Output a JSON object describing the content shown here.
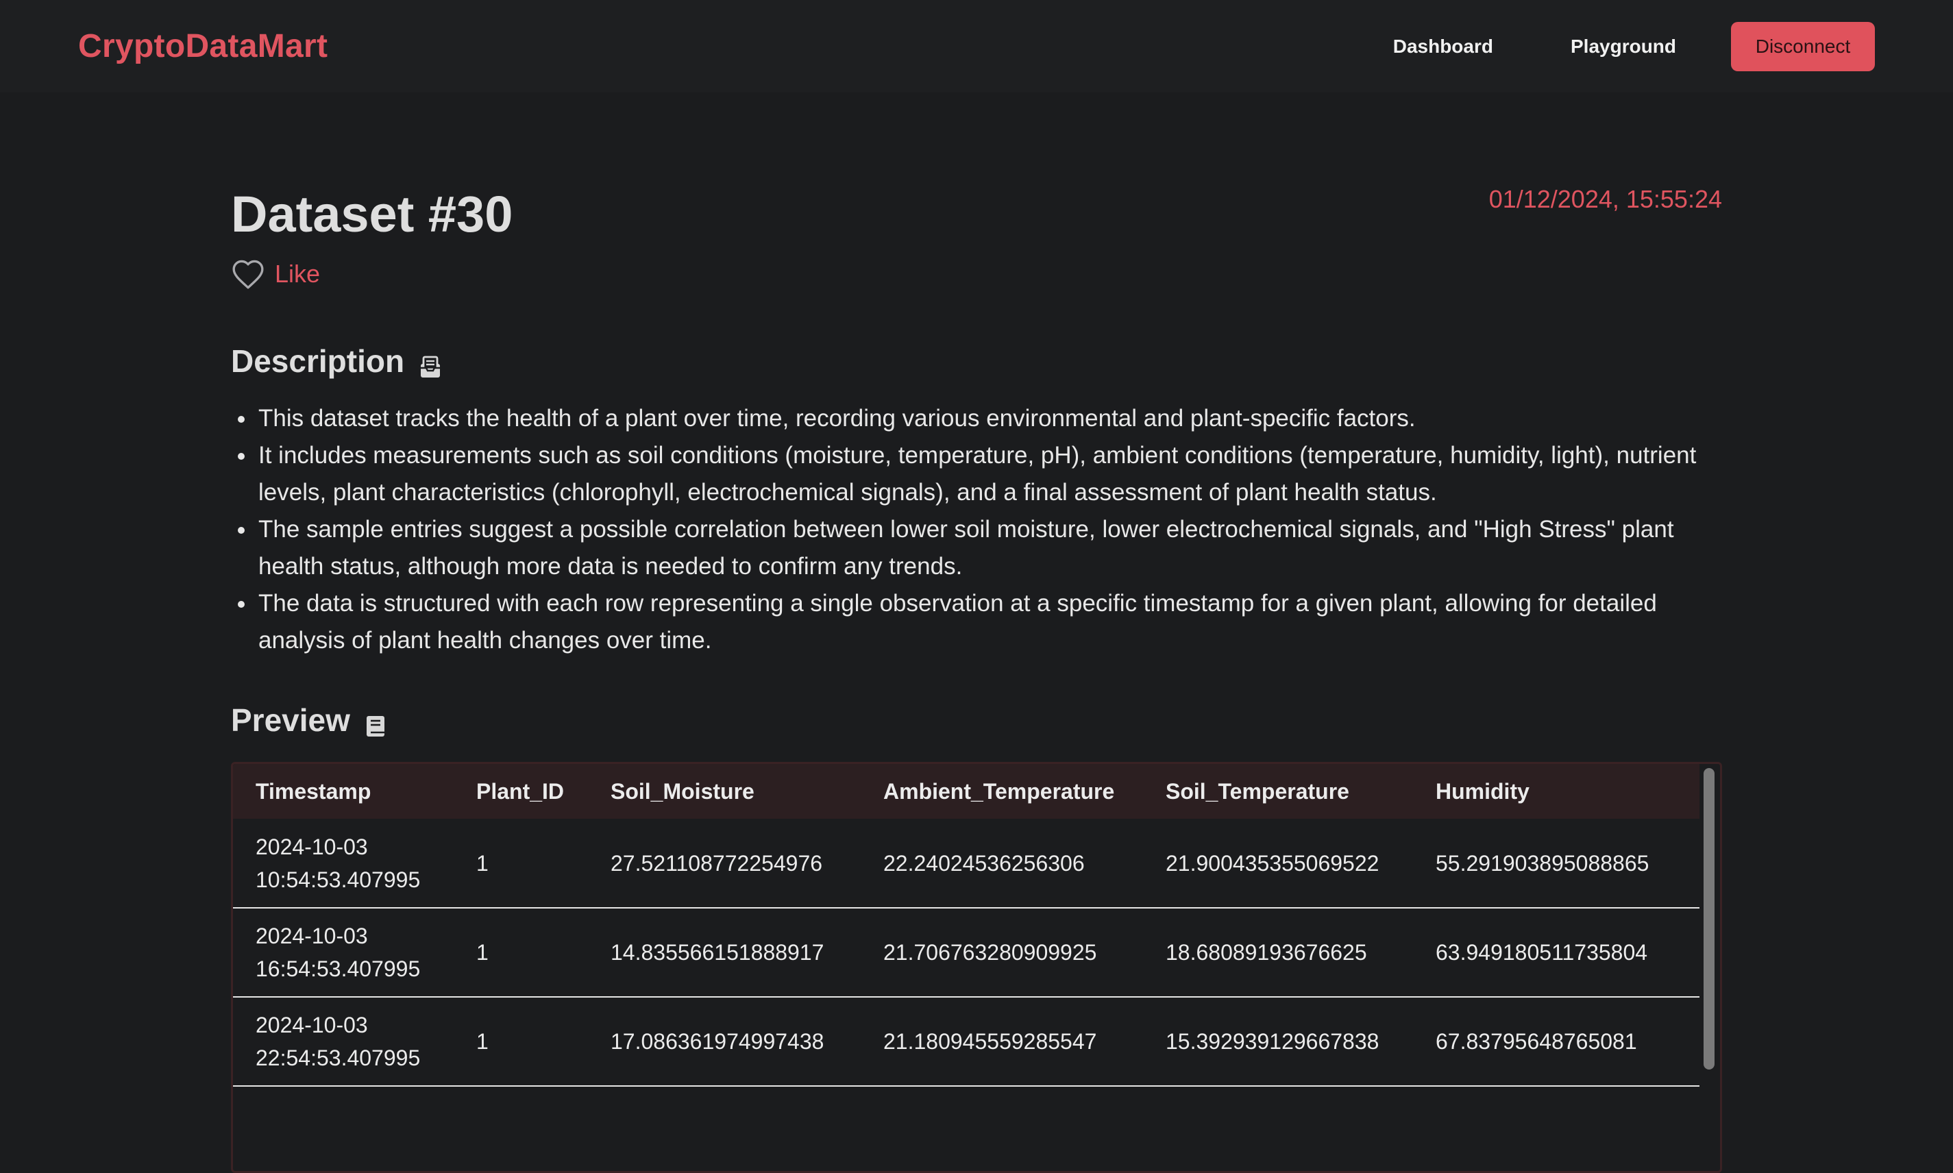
{
  "nav": {
    "brand": "CryptoDataMart",
    "links": [
      "Dashboard",
      "Playground"
    ],
    "disconnect_label": "Disconnect"
  },
  "dataset": {
    "title": "Dataset #30",
    "timestamp": "01/12/2024, 15:55:24",
    "like_label": "Like"
  },
  "description": {
    "heading": "Description",
    "icon": "inbox-icon",
    "items": [
      "This dataset tracks the health of a plant over time, recording various environmental and plant-specific factors.",
      "It includes measurements such as soil conditions (moisture, temperature, pH), ambient conditions (temperature, humidity, light), nutrient levels, plant characteristics (chlorophyll, electrochemical signals), and a final assessment of plant health status.",
      "The sample entries suggest a possible correlation between lower soil moisture, lower electrochemical signals, and \"High Stress\" plant health status, although more data is needed to confirm any trends.",
      "The data is structured with each row representing a single observation at a specific timestamp for a given plant, allowing for detailed analysis of plant health changes over time."
    ]
  },
  "preview": {
    "heading": "Preview",
    "icon": "book-icon",
    "columns": [
      "Timestamp",
      "Plant_ID",
      "Soil_Moisture",
      "Ambient_Temperature",
      "Soil_Temperature",
      "Humidity"
    ],
    "rows": [
      [
        "2024-10-03\n10:54:53.407995",
        "1",
        "27.521108772254976",
        "22.24024536256306",
        "21.900435355069522",
        "55.291903895088865"
      ],
      [
        "2024-10-03\n16:54:53.407995",
        "1",
        "14.835566151888917",
        "21.706763280909925",
        "18.68089193676625",
        "63.949180511735804"
      ],
      [
        "2024-10-03\n22:54:53.407995",
        "1",
        "17.086361974997438",
        "21.180945559285547",
        "15.392939129667838",
        "67.83795648765081"
      ]
    ]
  },
  "colors": {
    "accent": "#e05560",
    "background": "#1b1c1e",
    "navbar": "#1e1f21",
    "table_header": "#2c1f21"
  }
}
